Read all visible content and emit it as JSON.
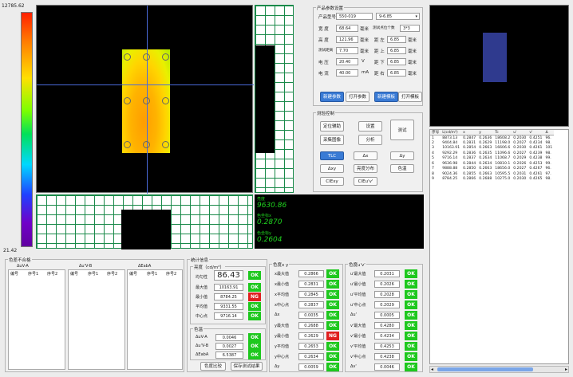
{
  "colorbar": {
    "max": "12785.62",
    "min": "21.42"
  },
  "readout": {
    "luminance_label": "亮度",
    "luminance_value": "9630.86",
    "x_label": "色坐标x",
    "x_value": "0.2870",
    "y_label": "色坐标y",
    "y_value": "0.2604"
  },
  "params": {
    "title": "产品参数设置",
    "model_label": "产品型号",
    "model_value": "550-019",
    "model_select": "9-6.85",
    "width_label": "宽 度",
    "width_value": "68.64",
    "width_unit": "毫米",
    "points_label": "测试点位个数",
    "points_value": "3*3",
    "height_label": "高 度",
    "height_value": "121.96",
    "height_unit": "毫米",
    "left_label": "距 左",
    "left_value": "6.85",
    "left_unit": "毫米",
    "dist_label": "测试距离",
    "dist_value": "7.70",
    "dist_unit": "毫米",
    "top_label": "距 上",
    "top_value": "6.85",
    "top_unit": "毫米",
    "voltage_label": "电 压",
    "voltage_value": "20.40",
    "voltage_unit": "V",
    "bottom_label": "距 下",
    "bottom_value": "6.85",
    "bottom_unit": "毫米",
    "current_label": "电 流",
    "current_value": "40.00",
    "current_unit": "mA",
    "right_label": "距 右",
    "right_value": "6.85",
    "right_unit": "毫米",
    "btn_save": "新建参数",
    "btn_open": "打开参数",
    "btn_new_tpl": "新建模板",
    "btn_open_tpl": "打开模板"
  },
  "control": {
    "title": "测验控制",
    "btn_locate": "定位辅助",
    "btn_settings": "设置",
    "btn_test": "测试",
    "btn_capture": "采集图像",
    "btn_analyze": "分析",
    "btn_ltc": "TLC",
    "btn_dx": "Δx",
    "btn_dy": "Δy",
    "btn_dxy": "Δxy",
    "btn_lumdist": "亮度分布",
    "btn_temp": "色温",
    "btn_ciexy": "CIExy",
    "btn_cieuv": "CIEu'v'"
  },
  "results": {
    "headers": [
      "序号",
      "L(cd/m²)",
      "x",
      "y",
      "Tc",
      "u'",
      "v'",
      "Δ"
    ],
    "rows": [
      [
        "1",
        "8873.13",
        "0.2847",
        "0.2636",
        "18608.2",
        "0.2030",
        "0.4251",
        "96."
      ],
      [
        "2",
        "9404.84",
        "0.2831",
        "0.2629",
        "11198.0",
        "0.2027",
        "0.4234",
        "98."
      ],
      [
        "3",
        "10163.91",
        "0.2854",
        "0.2663",
        "16606.6",
        "0.2030",
        "0.4261",
        "101"
      ],
      [
        "4",
        "9292.29",
        "0.2836",
        "0.2635",
        "11096.6",
        "0.2027",
        "0.4239",
        "98."
      ],
      [
        "5",
        "9716.14",
        "0.2837",
        "0.2634",
        "11068.7",
        "0.2029",
        "0.4238",
        "99."
      ],
      [
        "6",
        "9636.98",
        "0.2844",
        "0.2634",
        "10810.1",
        "0.2026",
        "0.4253",
        "99."
      ],
      [
        "7",
        "9888.88",
        "0.2850",
        "0.2663",
        "18656.0",
        "0.2027",
        "0.4267",
        "96."
      ],
      [
        "8",
        "9024.36",
        "0.2855",
        "0.2663",
        "10595.5",
        "0.2031",
        "0.4261",
        "97."
      ],
      [
        "9",
        "8784.25",
        "0.2866",
        "0.2688",
        "10275.0",
        "0.2030",
        "0.4265",
        "98."
      ]
    ]
  },
  "tolerance": {
    "title": "色差不合格",
    "col1": "ΔuV-A",
    "col2": "Δu'V-B",
    "col3": "ΔEabA",
    "sub1": "编号",
    "sub2": "序号1",
    "sub3": "序号2"
  },
  "stats": {
    "title": "统计信息",
    "lum_group": "亮度（cd/m²）",
    "uniform_label": "均匀性",
    "uniform_value": "86.43",
    "max_label": "最大值",
    "max_value": "10163.91",
    "min_label": "最小值",
    "min_value": "8784.25",
    "avg_label": "平均值",
    "avg_value": "9331.55",
    "center_label": "中心点",
    "center_value": "9716.14",
    "color_group": "色温",
    "dva_label": "ΔuV-A",
    "dva_value": "0.0046",
    "dvb_label": "Δu'V-B",
    "dvb_value": "0.0027",
    "deab_label": "ΔEabA",
    "deab_value": "6.5387",
    "btn_compare": "色度比较",
    "btn_save": "保存测试结果"
  },
  "xy_group": {
    "title": "色度x y",
    "rows": [
      {
        "label": "x最大值",
        "value": "0.2866",
        "status": "OK"
      },
      {
        "label": "x最小值",
        "value": "0.2831",
        "status": "OK"
      },
      {
        "label": "x平均值",
        "value": "0.2845",
        "status": "OK"
      },
      {
        "label": "x中心点",
        "value": "0.2837",
        "status": "OK"
      },
      {
        "label": "Δx",
        "value": "0.0035",
        "status": "OK"
      },
      {
        "label": "y最大值",
        "value": "0.2688",
        "status": "OK"
      },
      {
        "label": "y最小值",
        "value": "0.2629",
        "status": "NG"
      },
      {
        "label": "y平均值",
        "value": "0.2653",
        "status": "OK"
      },
      {
        "label": "y中心点",
        "value": "0.2634",
        "status": "OK"
      },
      {
        "label": "Δy",
        "value": "0.0059",
        "status": "OK"
      }
    ]
  },
  "uv_group": {
    "title": "色度u'v'",
    "rows": [
      {
        "label": "u'最大值",
        "value": "0.2031",
        "status": "OK"
      },
      {
        "label": "u'最小值",
        "value": "0.2026",
        "status": "OK"
      },
      {
        "label": "u'平均值",
        "value": "0.2028",
        "status": "OK"
      },
      {
        "label": "u'中心点",
        "value": "0.2029",
        "status": "OK"
      },
      {
        "label": "Δu'",
        "value": "0.0005",
        "status": "OK"
      },
      {
        "label": "v'最大值",
        "value": "0.4280",
        "status": "OK"
      },
      {
        "label": "v'最小值",
        "value": "0.4234",
        "status": "OK"
      },
      {
        "label": "v'平均值",
        "value": "0.4253",
        "status": "OK"
      },
      {
        "label": "v'中心点",
        "value": "0.4238",
        "status": "OK"
      },
      {
        "label": "Δv'",
        "value": "0.0046",
        "status": "OK"
      }
    ]
  },
  "statuses": {
    "ok": "OK",
    "ng": "NG",
    "lum_max": "OK",
    "lum_min": "NG",
    "lum_avg": "OK",
    "lum_center": "OK",
    "lum_uniform": "OK",
    "dva": "OK",
    "dvb": "OK",
    "deab": "OK"
  },
  "icons": {
    "dropdown": "chevron-down-icon",
    "spin": "spinner-icon"
  }
}
